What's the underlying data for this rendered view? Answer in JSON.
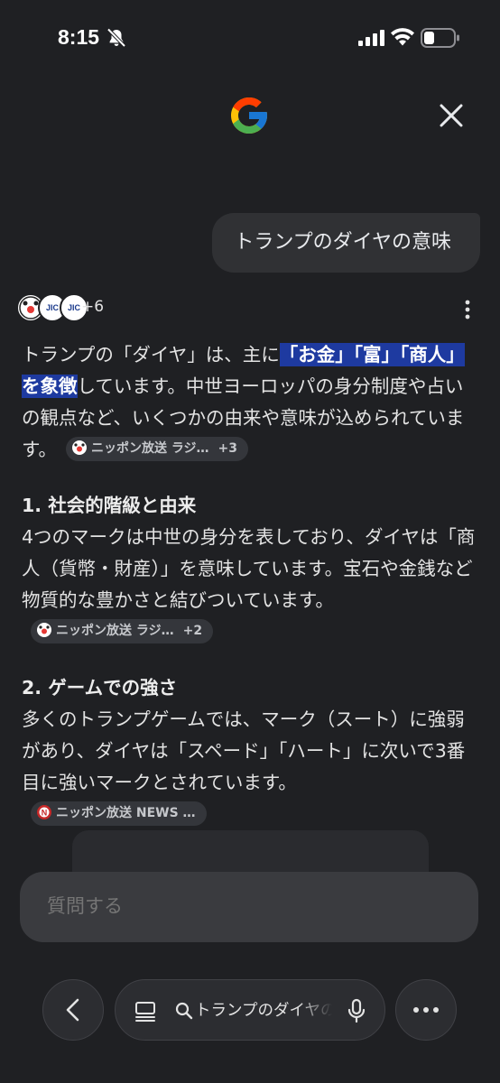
{
  "status_bar": {
    "time": "8:15",
    "icons": [
      "bell-off-icon",
      "signal-icon",
      "wifi-icon",
      "battery-icon"
    ]
  },
  "header": {
    "logo": "google-g-logo",
    "close_icon": "close-icon"
  },
  "query": {
    "text": "トランプのダイヤの意味"
  },
  "sources": {
    "avatar_labels": [
      "JIC",
      "JIC"
    ],
    "more_count": "+6"
  },
  "answer": {
    "intro": {
      "before": "トランプの「ダイヤ」は、主に",
      "highlight1": "「お金」「富」",
      "highlight2": "「商人」を象徴",
      "after": "しています。中世ヨーロッパの身分制度や占いの観点など、いくつかの由来や意味が込められています。",
      "chip": {
        "label": "ニッポン放送 ラジ…",
        "plus": "+3"
      }
    },
    "sections": [
      {
        "heading": "1. 社会的階級と由来",
        "body": "4つのマークは中世の身分を表しており、ダイヤは「商人（貨幣・財産）」を意味しています。宝石や金銭など物質的な豊かさと結びついています。",
        "chip": {
          "label": "ニッポン放送 ラジ…",
          "plus": "+2"
        }
      },
      {
        "heading": "2. ゲームでの強さ",
        "body": "多くのトランプゲームでは、マーク（スート）に強弱があり、ダイヤは「スペード」「ハート」に次いで3番目に強いマークとされています。",
        "chip": {
          "label": "ニッポン放送 NEWS …",
          "plus": ""
        }
      }
    ]
  },
  "ask": {
    "placeholder": "質問する"
  },
  "bottom_nav": {
    "back_icon": "chevron-left-icon",
    "tabs_icon": "tabs-icon",
    "search_icon": "search-icon",
    "search_text": "トランプのダイヤの意味",
    "mic_icon": "mic-icon",
    "more_icon": "more-horizontal-icon"
  },
  "colors": {
    "background": "#1f2023",
    "highlight": "#1e3aa0",
    "bubble": "#303134",
    "chip": "#34363b"
  }
}
